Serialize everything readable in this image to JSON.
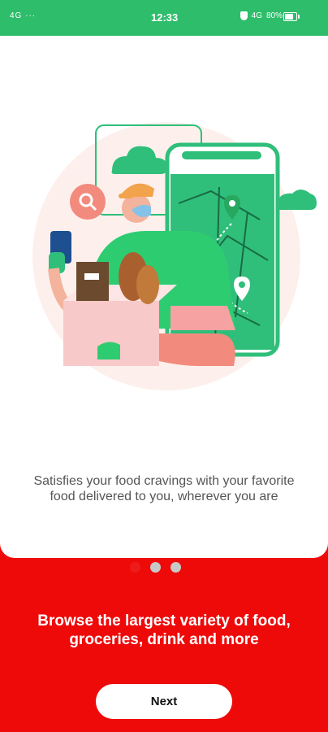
{
  "status_bar": {
    "left_indicators": "4G ···",
    "time": "12:33",
    "network": "4G",
    "battery": "80%",
    "icons": [
      "shield-icon",
      "signal-icon",
      "battery-icon"
    ]
  },
  "onboarding": {
    "illustration": "delivery-man-with-groceries-and-map-phone",
    "description": "Satisfies your food cravings with your favorite food delivered to you, wherever you are",
    "pagination": {
      "total": 3,
      "active_index": 0
    },
    "headline": "Browse the largest variety of food, groceries, drink and more",
    "next_label": "Next"
  },
  "colors": {
    "status_bar": "#2ebd6b",
    "primary_red": "#ef0a0a",
    "map_green": "#2fbf7a",
    "card": "#ffffff",
    "dot_inactive": "#c8c8c8"
  }
}
